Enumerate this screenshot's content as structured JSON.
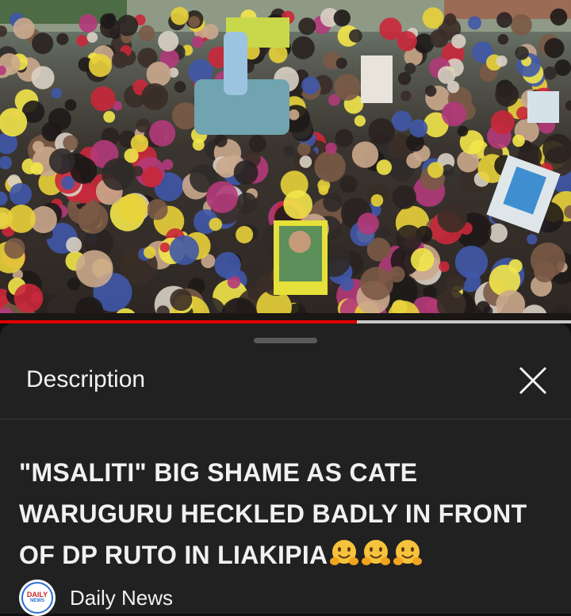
{
  "player": {
    "scene": "rally-crowd-thumbnail",
    "progress_fraction": 0.625,
    "progress_color": "#e00000"
  },
  "description_sheet": {
    "title": "Description",
    "close_icon": "close-icon",
    "video_title": "\"MSALITI\" BIG SHAME AS CATE WARUGURU HECKLED BADLY IN FRONT OF DP RUTO IN LIAKIPIA",
    "title_emojis": [
      "hugging-face-emoji",
      "hugging-face-emoji",
      "hugging-face-emoji"
    ],
    "channel": {
      "name": "Daily News",
      "avatar_text_top": "DAILY",
      "avatar_text_bottom": "NEWS"
    }
  },
  "colors": {
    "sheet_background": "#212121",
    "page_background": "#0f0f0f",
    "text": "#f1f1f1"
  }
}
